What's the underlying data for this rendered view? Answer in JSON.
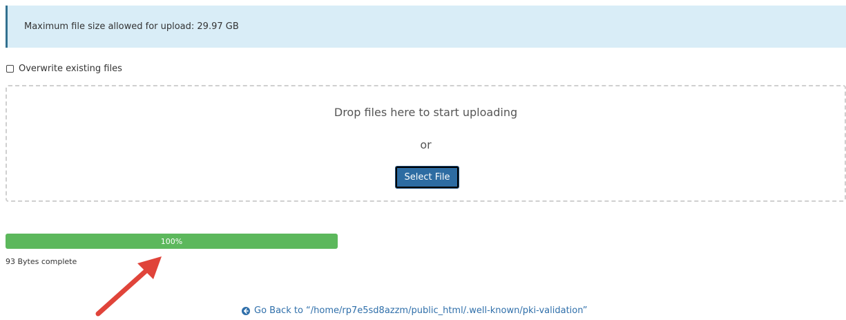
{
  "alert": {
    "text": "Maximum file size allowed for upload: 29.97 GB"
  },
  "overwrite": {
    "label": "Overwrite existing files",
    "checked": false
  },
  "dropzone": {
    "title": "Drop files here to start uploading",
    "or_text": "or",
    "select_button_label": "Select File"
  },
  "progress": {
    "percent": 100,
    "label": "100%"
  },
  "status": {
    "bytes_complete": "93 Bytes complete"
  },
  "back_link": {
    "label": "Go Back to “/home/rp7e5sd8azzm/public_html/.well-known/pki-validation”"
  },
  "colors": {
    "alert_bg": "#d9edf7",
    "progress_green": "#5cb85c",
    "button_blue": "#2d6ca2",
    "link_blue": "#2f6faa",
    "annotation_arrow": "#e0443a"
  },
  "icons": {
    "back_icon": "circle-arrow-left-icon",
    "annotation": "red-arrow-annotation"
  }
}
